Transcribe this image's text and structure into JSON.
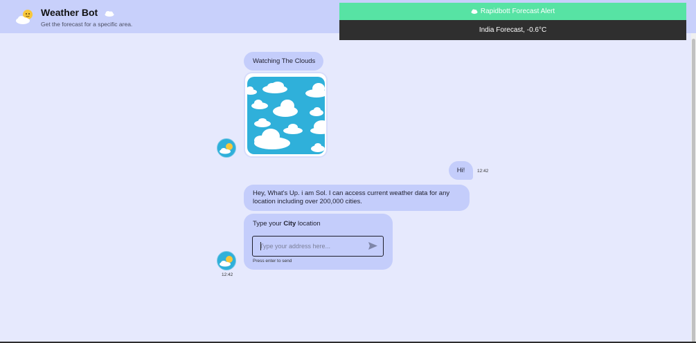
{
  "header": {
    "title": "Weather Bot",
    "subtitle": "Get the forecast for a specific area.",
    "logo_icon": "sun-cloud-icon",
    "title_icon": "cloud-icon"
  },
  "alert": {
    "title": "Rapidbott Forecast Alert",
    "message": "India Forecast, -0.6°C",
    "header_color": "#57e3a4",
    "body_color": "#2f2f2f"
  },
  "chat": {
    "messages": [
      {
        "from": "bot",
        "text": "Watching The Clouds"
      },
      {
        "from": "bot",
        "image": "clouds-image"
      },
      {
        "from": "user",
        "text": "Hi!",
        "time": "12:42"
      },
      {
        "from": "bot",
        "text": "Hey, What's Up. i am Sol. I can access current weather data for any location including over 200,000 cities."
      },
      {
        "from": "bot",
        "prompt_pre": "Type your",
        "prompt_bold": "City",
        "prompt_post": "location",
        "time": "12:42"
      }
    ],
    "input": {
      "placeholder": "Type your address here...",
      "value": "",
      "hint": "Press enter to send",
      "send_icon": "send-icon"
    }
  },
  "colors": {
    "background": "#e6e9fd",
    "header_bg": "#c8d0fb",
    "bubble_bg": "#c4cdfb",
    "sky": "#2fb0da"
  }
}
